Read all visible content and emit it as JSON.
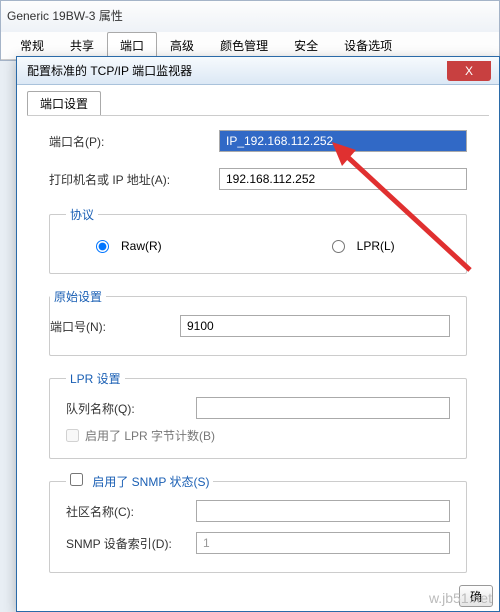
{
  "outer": {
    "title": "Generic 19BW-3 属性",
    "tabs": [
      "常规",
      "共享",
      "端口",
      "高级",
      "颜色管理",
      "安全",
      "设备选项"
    ],
    "active_tab": "端口"
  },
  "dialog": {
    "title": "配置标准的 TCP/IP 端口监视器",
    "close": "X",
    "tab": "端口设置",
    "port_name_label": "端口名(P):",
    "port_name_value": "IP_192.168.112.252",
    "address_label": "打印机名或 IP 地址(A):",
    "address_value": "192.168.112.252",
    "protocol": {
      "legend": "协议",
      "raw": "Raw(R)",
      "lpr": "LPR(L)",
      "selected": "raw"
    },
    "raw_settings": {
      "legend": "原始设置",
      "port_no_label": "端口号(N):",
      "port_no_value": "9100"
    },
    "lpr_settings": {
      "legend": "LPR 设置",
      "queue_label": "队列名称(Q):",
      "queue_value": "",
      "byte_count_label": "启用了 LPR 字节计数(B)"
    },
    "snmp": {
      "enable_label": "启用了 SNMP 状态(S)",
      "community_label": "社区名称(C):",
      "community_value": "",
      "index_label": "SNMP 设备索引(D):",
      "index_value": "1"
    },
    "ok": "确"
  },
  "watermark": "w.jb51.net"
}
